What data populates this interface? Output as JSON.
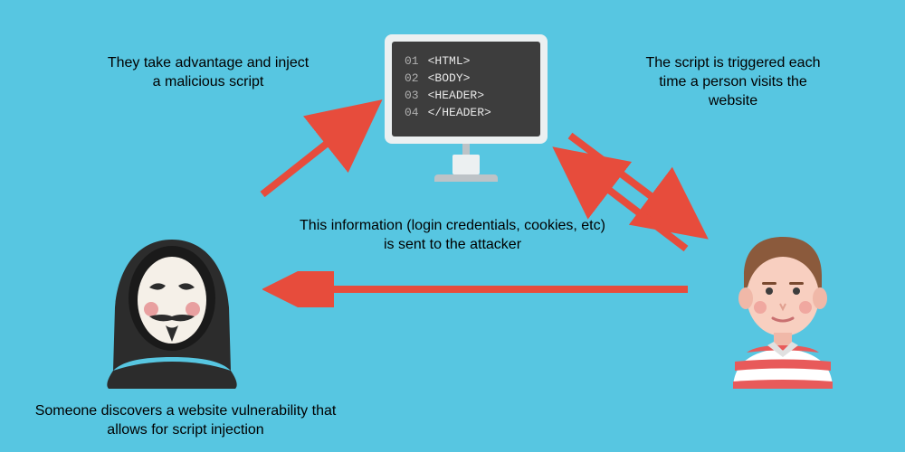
{
  "labels": {
    "inject": "They take advantage and inject a malicious script",
    "triggered": "The script is triggered each time a person visits the website",
    "info_sent": "This information (login credentials, cookies, etc) is sent to the attacker",
    "discover": "Someone discovers a website vulnerability that allows for script injection"
  },
  "code": {
    "lines": [
      {
        "num": "01",
        "tag": "<HTML>"
      },
      {
        "num": "02",
        "tag": "<BODY>"
      },
      {
        "num": "03",
        "tag": "<HEADER>"
      },
      {
        "num": "04",
        "tag": "</HEADER>"
      }
    ]
  },
  "colors": {
    "bg": "#57c6e1",
    "arrow": "#e74c3c",
    "screen": "#3d3d3d",
    "monitor": "#ecf0f1"
  }
}
